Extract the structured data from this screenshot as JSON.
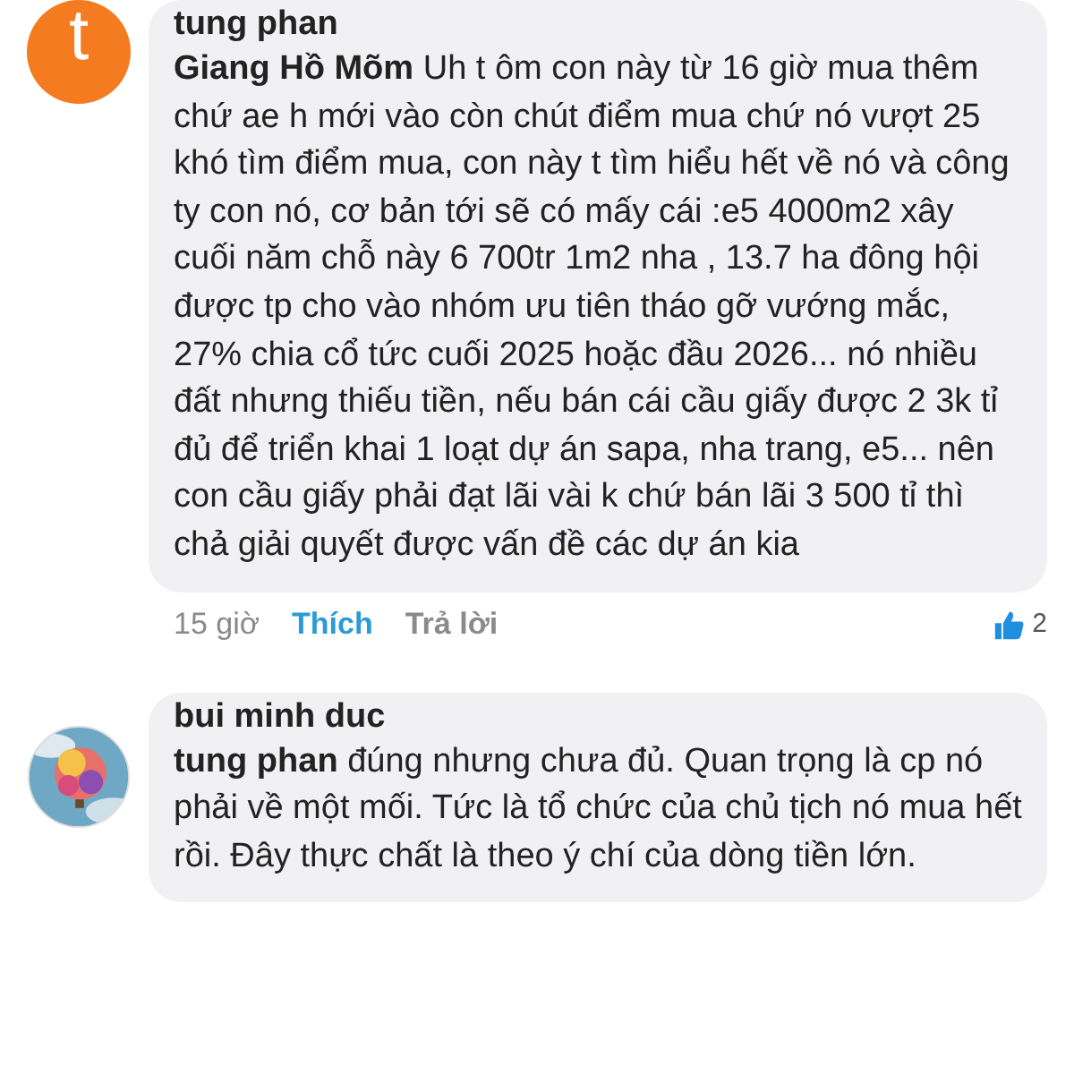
{
  "comments": [
    {
      "avatar": {
        "kind": "letter",
        "letter": "t",
        "color": "#f47b20"
      },
      "author": "tung phan",
      "text": "**Giang Hồ Mõm**  Uh t ôm con này từ 16 giờ mua thêm chứ ae h mới vào còn chút điểm mua chứ nó vượt 25 khó tìm điểm mua, con này t tìm hiểu hết về nó và công ty con nó, cơ bản tới sẽ có mấy cái  :e5 4000m2 xây cuối năm chỗ này 6 700tr 1m2 nha , 13.7 ha đông hội được tp cho vào nhóm ưu tiên tháo gỡ vướng mắc, 27% chia cổ tức cuối 2025 hoặc đầu 2026... nó nhiều đất nhưng thiếu tiền, nếu bán cái cầu giấy được 2 3k tỉ đủ để triển khai 1 loạt dự án sapa, nha trang, e5... nên con cầu giấy phải đạt lãi vài k chứ bán lãi 3 500 tỉ thì chả giải quyết được vấn đề các dự án kia",
      "meta": {
        "time": "15 giờ",
        "like": "Thích",
        "liked": true,
        "reply": "Trả lời",
        "like_count": "2"
      }
    },
    {
      "author": "bui minh duc",
      "text": "**tung phan**  đúng nhưng chưa đủ. Quan trọng là cp nó phải về một mối. Tức là tổ chức của chủ tịch nó mua hết rồi. Đây thực chất là theo ý chí của dòng tiền lớn."
    }
  ]
}
